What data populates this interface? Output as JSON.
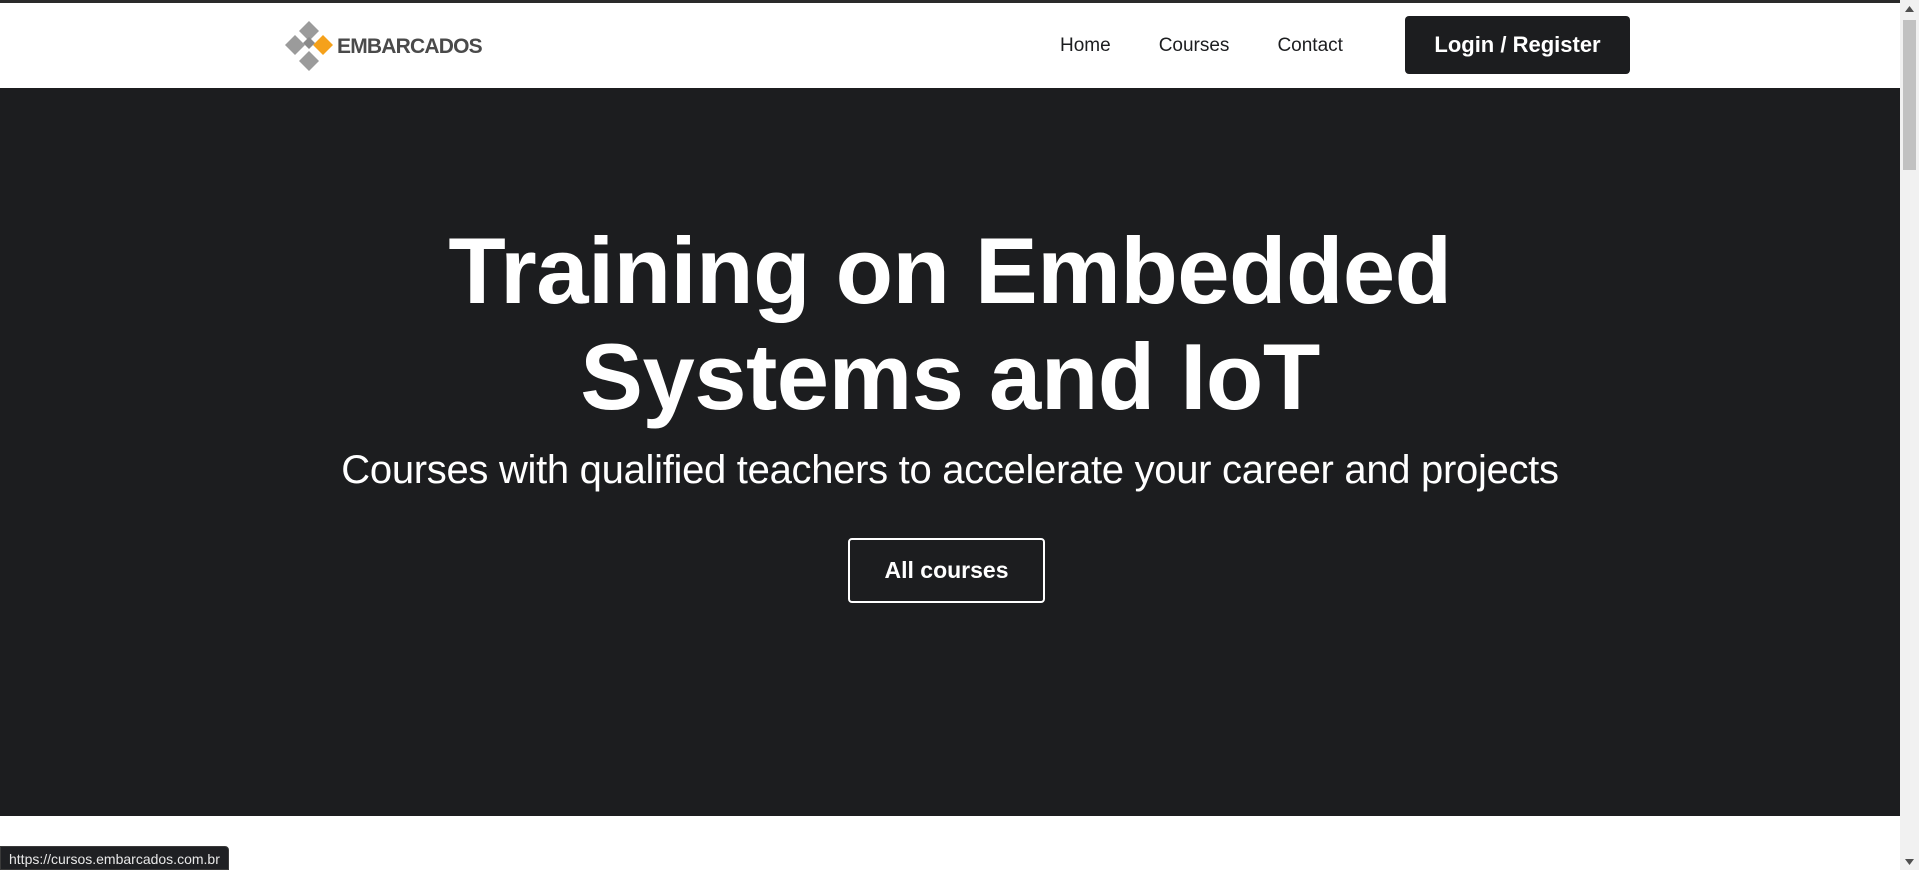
{
  "header": {
    "logo_text": "EMBARCADOS",
    "nav": [
      {
        "label": "Home"
      },
      {
        "label": "Courses"
      },
      {
        "label": "Contact"
      }
    ],
    "login_label": "Login / Register"
  },
  "hero": {
    "title": "Training on Embedded Systems and IoT",
    "subtitle": "Courses with qualified teachers to accelerate your career and projects",
    "button_label": "All courses"
  },
  "status_bar": {
    "url": "https://cursos.embarcados.com.br"
  },
  "colors": {
    "dark": "#1c1d1f",
    "white": "#ffffff",
    "logo_gray": "#8c8c8c",
    "logo_orange": "#f5a11b"
  },
  "icons": {
    "logo": "embarcados-logo-icon",
    "scroll_up": "chevron-up-icon",
    "scroll_down": "chevron-down-icon"
  }
}
